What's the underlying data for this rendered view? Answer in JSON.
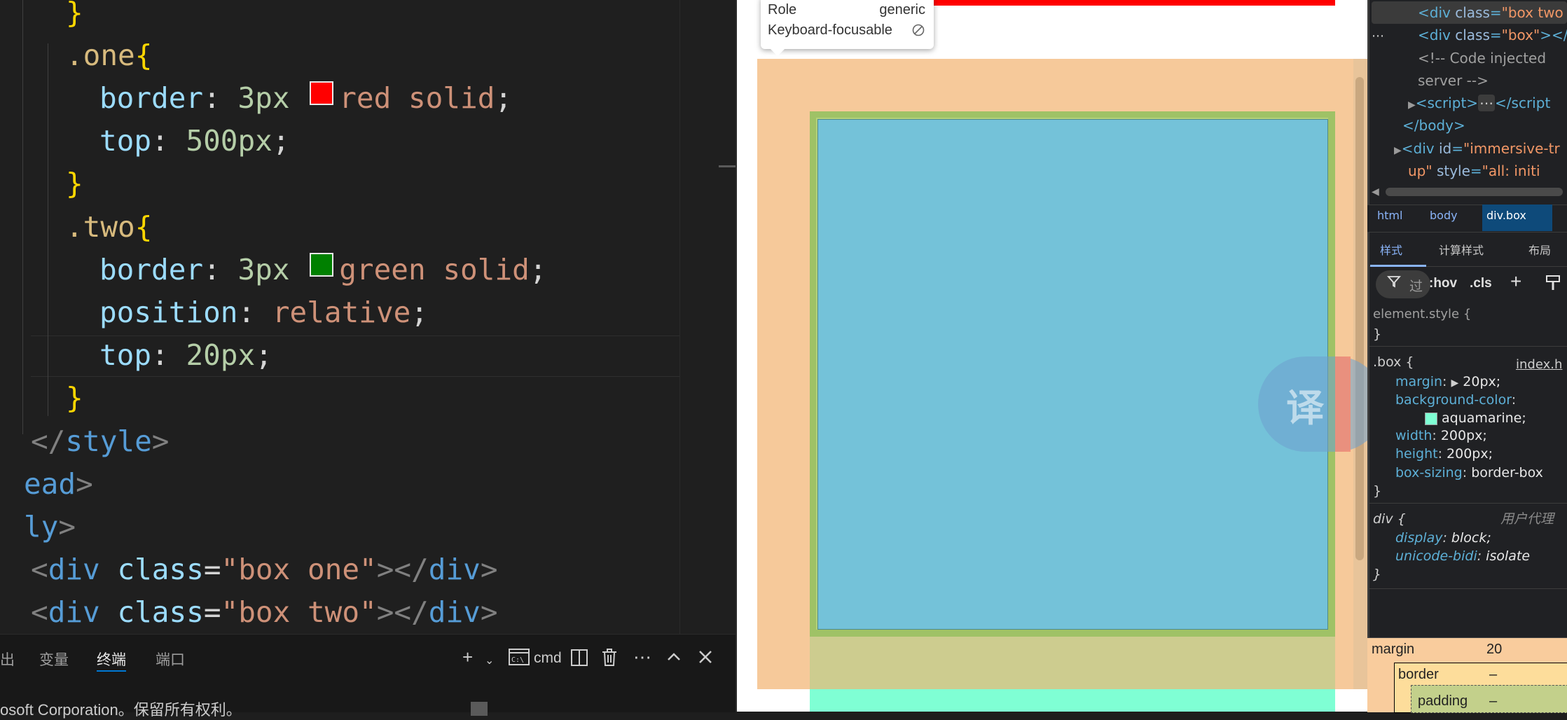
{
  "editor": {
    "lines": [
      {
        "text": "}"
      },
      {
        "selector": ".one",
        "brace": "{"
      },
      {
        "prop": "border",
        "num": "3px",
        "swatch": "#ff0000",
        "val": "red solid",
        "end": ";"
      },
      {
        "prop": "top",
        "num": "500px",
        "end": ";"
      },
      {
        "brace": "}"
      },
      {
        "selector": ".two",
        "brace": "{"
      },
      {
        "prop": "border",
        "num": "3px",
        "swatch": "#008000",
        "val": "green solid",
        "end": ";"
      },
      {
        "prop": "position",
        "val": "relative",
        "end": ";"
      },
      {
        "prop": "top",
        "num": "20px",
        "end": ";"
      },
      {
        "brace": "}"
      }
    ],
    "style_close": "style",
    "head_close": "ead",
    "body_open": "ly",
    "div1": {
      "tag": "div",
      "attr": "class",
      "value": "\"box one\""
    },
    "div2": {
      "tag": "div",
      "attr": "class",
      "value": "\"box two\""
    }
  },
  "panel": {
    "tabs": [
      "出",
      "变量",
      "终端",
      "端口"
    ],
    "active_tab": "终端",
    "shell": "cmd",
    "terminal_line": "osoft Corporation。保留所有权利。"
  },
  "tooltip": {
    "role_label": "Role",
    "role_value": "generic",
    "focus_label": "Keyboard-focusable",
    "focus_icon": "not-allowed-icon"
  },
  "translate_glyph": "译",
  "devtools": {
    "dom": {
      "line1": {
        "tag": "div",
        "attr": "class",
        "value": "\"box two"
      },
      "line2": {
        "tag": "div",
        "attr": "class",
        "value": "\"box\"",
        "rest": "></"
      },
      "comment1": "<!-- Code injected",
      "comment2": "server -->",
      "script": "script",
      "body_close": "</body>",
      "div_id": {
        "tag": "div",
        "attr": "id",
        "value": "\"immersive-tr"
      },
      "div_style": {
        "pre": "up\"",
        "attr": "style",
        "value": "\"all: initi"
      }
    },
    "breadcrumb": [
      "html",
      "body",
      "div.box"
    ],
    "tabs": [
      "样式",
      "计算样式",
      "布局"
    ],
    "filter": {
      "placeholder": "过",
      "hov": ":hov",
      "cls": ".cls"
    },
    "styles": {
      "element_style": "element.style {",
      "close": "}",
      "box_selector": ".box {",
      "box_source": "index.h",
      "margin_prop": "margin",
      "margin_val": "20px;",
      "bg_prop": "background-color",
      "bg_val": "aquamarine;",
      "width_prop": "width",
      "width_val": "200px;",
      "height_prop": "height",
      "height_val": "200px;",
      "sizing_prop": "box-sizing",
      "sizing_val": "border-box",
      "div_selector": "div {",
      "ua_label": "用户代理",
      "display_prop": "display",
      "display_val": "block;",
      "bidi_prop": "unicode-bidi",
      "bidi_val": "isolate"
    },
    "boxmodel": {
      "margin_label": "margin",
      "margin_value": "20",
      "border_label": "border",
      "border_value": "–",
      "padding_label": "padding",
      "padding_value": "–"
    }
  },
  "colors": {
    "red_border": "#ff0000",
    "green_border": "#008000",
    "aquamarine": "#7fffd4",
    "margin_highlight": "#f6c99a",
    "content_highlight": "#74c2d9"
  }
}
